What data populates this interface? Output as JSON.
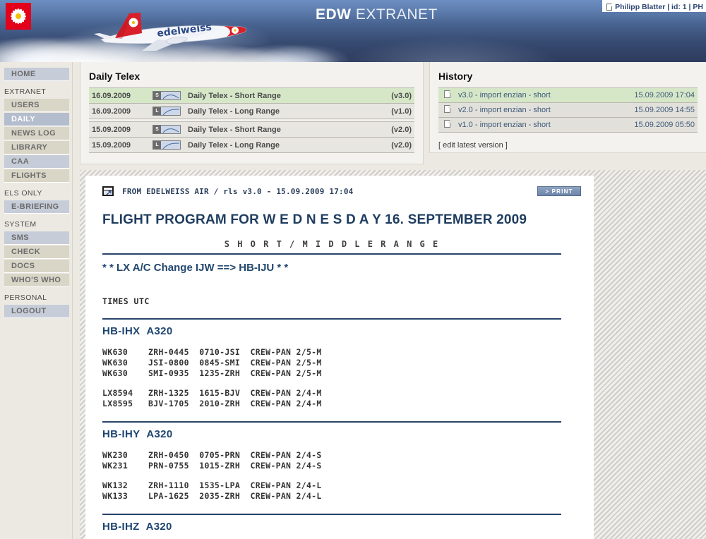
{
  "header": {
    "logo_alt": "edelweiss-logo",
    "title_bold": "EDW",
    "title_rest": " EXTRANET",
    "user_info": "Philipp Blatter |  id: 1 |  PH"
  },
  "sidebar": {
    "top": [
      {
        "label": "HOME",
        "style": "blue",
        "active": false
      }
    ],
    "groups": [
      {
        "section": "EXTRANET",
        "items": [
          {
            "label": "USERS",
            "style": "beige",
            "active": false
          },
          {
            "label": "DAILY",
            "style": "blue",
            "active": true
          },
          {
            "label": "NEWS LOG",
            "style": "beige",
            "active": false
          },
          {
            "label": "LIBRARY",
            "style": "beige",
            "active": false
          },
          {
            "label": "CAA",
            "style": "blue",
            "active": false
          },
          {
            "label": "FLIGHTS",
            "style": "beige",
            "active": false
          }
        ]
      },
      {
        "section": "ELS ONLY",
        "items": [
          {
            "label": "E-BRIEFING",
            "style": "blue",
            "active": false
          }
        ]
      },
      {
        "section": "SYSTEM",
        "items": [
          {
            "label": "SMS",
            "style": "blue",
            "active": false
          },
          {
            "label": "CHECK",
            "style": "beige",
            "active": false
          },
          {
            "label": "DOCS",
            "style": "beige",
            "active": false
          },
          {
            "label": "WHO'S WHO",
            "style": "beige",
            "active": false
          }
        ]
      },
      {
        "section": "PERSONAL",
        "items": [
          {
            "label": "LOGOUT",
            "style": "blue",
            "active": false
          }
        ]
      }
    ]
  },
  "telex_panel": {
    "title": "Daily Telex",
    "rows": [
      {
        "date": "16.09.2009",
        "icon": "S",
        "name": "Daily Telex - Short Range",
        "version": "(v3.0)",
        "highlight": true
      },
      {
        "date": "16.09.2009",
        "icon": "L",
        "name": "Daily Telex - Long Range",
        "version": "(v1.0)",
        "highlight": false
      },
      {
        "spacer": true
      },
      {
        "date": "15.09.2009",
        "icon": "S",
        "name": "Daily Telex - Short Range",
        "version": "(v2.0)",
        "highlight": false
      },
      {
        "date": "15.09.2009",
        "icon": "L",
        "name": "Daily Telex - Long Range",
        "version": "(v2.0)",
        "highlight": false
      }
    ]
  },
  "history_panel": {
    "title": "History",
    "rows": [
      {
        "icon": "document-icon",
        "label": "v3.0 - import enzian - short",
        "timestamp": "15.09.2009 17:04",
        "highlight": true
      },
      {
        "icon": "document-icon",
        "label": "v2.0 - import enzian - short",
        "timestamp": "15.09.2009 14:55",
        "highlight": false
      },
      {
        "icon": "document-icon",
        "label": "v1.0 - import enzian - short",
        "timestamp": "15.09.2009 05:50",
        "highlight": false
      }
    ],
    "edit_link": "[ edit latest version ]"
  },
  "document": {
    "popup_icon": "popup-window-icon",
    "source_line": "FROM EDELWEISS AIR / rls v3.0 - 15.09.2009 17:04",
    "print_label": "> PRINT",
    "heading": "FLIGHT PROGRAM FOR  W E D N E S D A Y  16. SEPTEMBER 2009",
    "range_label": "S H O R T / M I D D L E   R A N G E",
    "note": "* * LX A/C Change IJW ==> HB-IJU * *",
    "times_label": "TIMES UTC",
    "aircraft": [
      {
        "registration": "HB-IHX",
        "type": "A320",
        "groups": [
          [
            "WK630    ZRH-0445  0710-JSI  CREW-PAN 2/5-M",
            "WK630    JSI-0800  0845-SMI  CREW-PAN 2/5-M",
            "WK630    SMI-0935  1235-ZRH  CREW-PAN 2/5-M"
          ],
          [
            "LX8594   ZRH-1325  1615-BJV  CREW-PAN 2/4-M",
            "LX8595   BJV-1705  2010-ZRH  CREW-PAN 2/4-M"
          ]
        ]
      },
      {
        "registration": "HB-IHY",
        "type": "A320",
        "groups": [
          [
            "WK230    ZRH-0450  0705-PRN  CREW-PAN 2/4-S",
            "WK231    PRN-0755  1015-ZRH  CREW-PAN 2/4-S"
          ],
          [
            "WK132    ZRH-1110  1535-LPA  CREW-PAN 2/4-L",
            "WK133    LPA-1625  2035-ZRH  CREW-PAN 2/4-L"
          ]
        ]
      },
      {
        "registration": "HB-IHZ",
        "type": "A320",
        "groups": []
      }
    ]
  },
  "colors": {
    "brand_red": "#e2001a",
    "header_blue": "#32456f",
    "doc_blue": "#1e4570",
    "highlight_green": "#d6e7c8",
    "nav_blue": "#c6ccd8",
    "nav_beige": "#d9d5c7"
  }
}
